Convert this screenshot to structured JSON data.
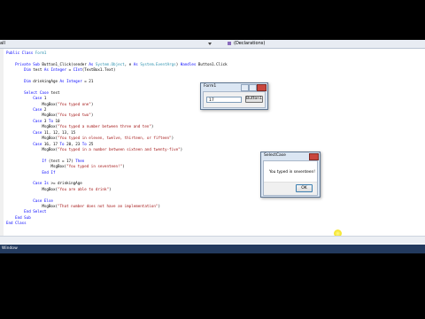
{
  "toolbar": {
    "left_combo": "all",
    "right_combo": "(Declarations)"
  },
  "code_lines": [
    [
      "kw",
      "Public Class ",
      "ty",
      "Form1"
    ],
    [],
    [
      "",
      "    ",
      "kw",
      "Private Sub ",
      "",
      "Button1_Click(sender ",
      "kw",
      "As ",
      "ty",
      "System.Object",
      "",
      ", e ",
      "kw",
      "As ",
      "ty",
      "System.EventArgs",
      "",
      ") ",
      "kw",
      "Handles ",
      "",
      "Button1.Click"
    ],
    [
      "",
      "        ",
      "kw",
      "Dim ",
      "",
      "test ",
      "kw",
      "As Integer ",
      "",
      "= ",
      "kw",
      "CInt",
      "",
      "(TextBox1.Text)"
    ],
    [],
    [
      "",
      "        ",
      "kw",
      "Dim ",
      "",
      "drinkingAge ",
      "kw",
      "As Integer ",
      "",
      "= 21"
    ],
    [],
    [
      "",
      "        ",
      "kw",
      "Select Case ",
      "",
      "test"
    ],
    [
      "",
      "            ",
      "kw",
      "Case ",
      "",
      "1"
    ],
    [
      "",
      "                ",
      "",
      "MsgBox(",
      "st",
      "\"You typed one\"",
      "",
      ")"
    ],
    [
      "",
      "            ",
      "kw",
      "Case ",
      "",
      "2"
    ],
    [
      "",
      "                ",
      "",
      "MsgBox(",
      "st",
      "\"You typed two\"",
      "",
      ")"
    ],
    [
      "",
      "            ",
      "kw",
      "Case ",
      "",
      "3 ",
      "kw",
      "To ",
      "",
      "10"
    ],
    [
      "",
      "                ",
      "",
      "MsgBox(",
      "st",
      "\"You typed a number between three and ten\"",
      "",
      ")"
    ],
    [
      "",
      "            ",
      "kw",
      "Case ",
      "",
      "11, 12, 13, 15"
    ],
    [
      "",
      "                ",
      "",
      "MsgBox(",
      "st",
      "\"You typed in eleven, twelve, thirteen, or fifteen\"",
      "",
      ")"
    ],
    [
      "",
      "            ",
      "kw",
      "Case ",
      "",
      "16, 17 ",
      "kw",
      "To ",
      "",
      "20, 23 ",
      "kw",
      "To ",
      "",
      "25"
    ],
    [
      "",
      "                ",
      "",
      "MsgBox(",
      "st",
      "\"You typed in a number between sixteen and twenty-five\"",
      "",
      ")"
    ],
    [],
    [
      "",
      "                ",
      "kw",
      "If ",
      "",
      "(test = 17) ",
      "kw",
      "Then"
    ],
    [
      "",
      "                    ",
      "",
      "MsgBox(",
      "st",
      "\"You typed in seventeen!\"",
      "",
      ")"
    ],
    [
      "",
      "                ",
      "kw",
      "End If"
    ],
    [],
    [
      "",
      "            ",
      "kw",
      "Case Is ",
      "",
      ">= drinkingAge"
    ],
    [
      "",
      "                ",
      "",
      "MsgBox(",
      "st",
      "\"You are able to drink\"",
      "",
      ")"
    ],
    [],
    [
      "",
      "            ",
      "kw",
      "Case Else"
    ],
    [
      "",
      "                ",
      "",
      "MsgBox(",
      "st",
      "\"That number does not have an implementation\"",
      "",
      ")"
    ],
    [
      "",
      "        ",
      "kw",
      "End Select"
    ],
    [
      "",
      "    ",
      "kw",
      "End Sub"
    ],
    [
      "kw",
      "End Class"
    ]
  ],
  "form1": {
    "title": "Form1",
    "input_value": "17",
    "button_label": "Button1"
  },
  "msgbox": {
    "title": "SelectCase",
    "message": "You typed in seventeen!",
    "ok_label": "OK"
  },
  "statusbar": {
    "text": "Window"
  },
  "colors": {
    "keyword": "#0000ff",
    "string": "#a31515",
    "type": "#2b91af",
    "status_bg": "#233a5e"
  }
}
